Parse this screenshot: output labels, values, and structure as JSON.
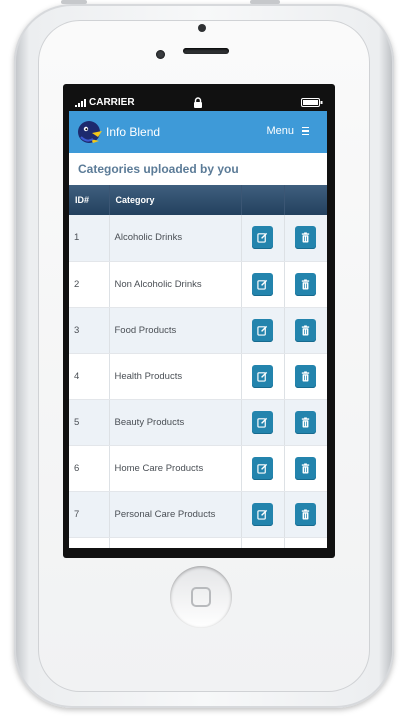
{
  "status_bar": {
    "carrier": "CARRIER"
  },
  "header": {
    "brand": "Info Blend",
    "menu_label": "Menu"
  },
  "page": {
    "title": "Categories uploaded by you"
  },
  "table": {
    "columns": [
      "ID#",
      "Category",
      "",
      ""
    ],
    "rows": [
      {
        "id": "1",
        "category": "Alcoholic Drinks"
      },
      {
        "id": "2",
        "category": "Non Alcoholic Drinks"
      },
      {
        "id": "3",
        "category": "Food Products"
      },
      {
        "id": "4",
        "category": "Health Products"
      },
      {
        "id": "5",
        "category": "Beauty Products"
      },
      {
        "id": "6",
        "category": "Home Care Products"
      },
      {
        "id": "7",
        "category": "Personal Care Products"
      },
      {
        "id": "",
        "category": ""
      }
    ]
  },
  "colors": {
    "header_bg": "#3e9ad8",
    "table_head_bg": "#2c4a68",
    "action_button": "#2384ad",
    "title_text": "#5b7b97"
  },
  "icons": {
    "edit": "edit-icon",
    "delete": "trash-icon",
    "menu": "hamburger-icon",
    "logo": "bird-logo"
  }
}
